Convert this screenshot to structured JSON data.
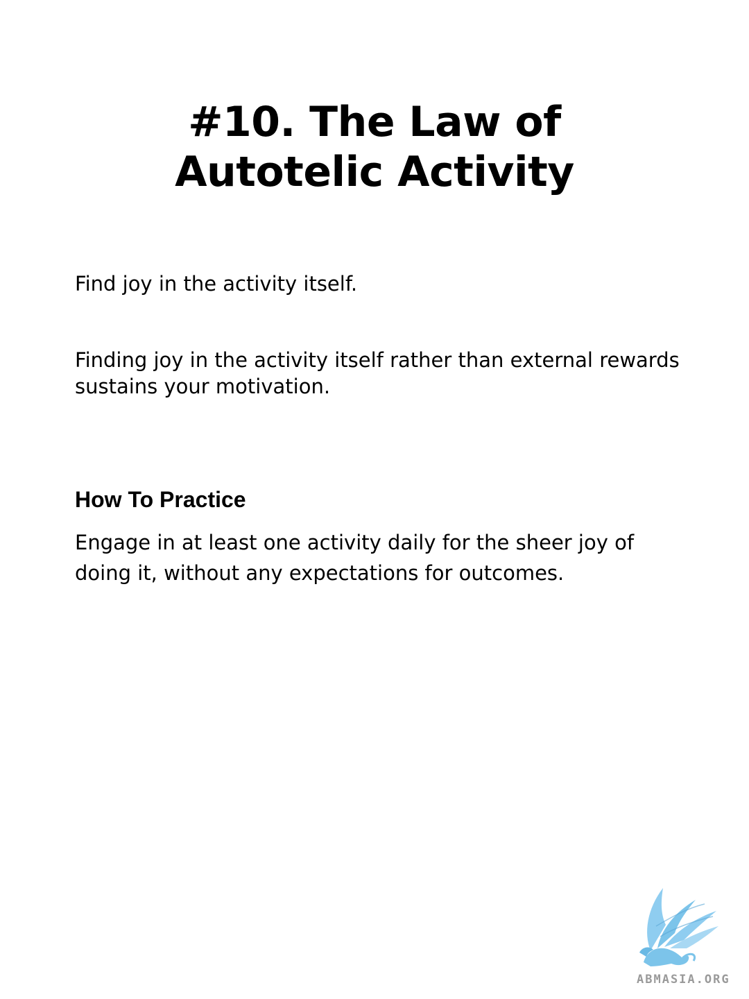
{
  "title": {
    "line1": "#10. The Law of",
    "line2": "Autotelic Activity"
  },
  "subtitle": "Find joy in the activity itself.",
  "description": "Finding joy in the activity itself rather than external rewards sustains your motivation.",
  "practice": {
    "heading": "How To Practice",
    "text": "Engage in at least one activity daily for the sheer joy of doing it, without any expectations for outcomes."
  },
  "logo": {
    "icon": "griffin-logo-icon",
    "text": "ABMASIA.ORG",
    "color": "#7cc4ea"
  }
}
